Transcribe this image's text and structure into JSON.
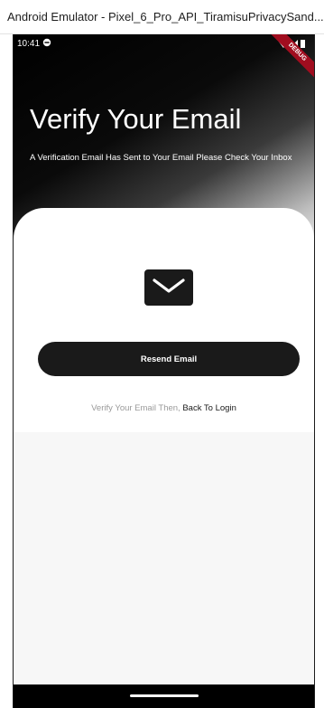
{
  "window": {
    "title": "Android Emulator - Pixel_6_Pro_API_TiramisuPrivacySand..."
  },
  "status_bar": {
    "time": "10:41",
    "debug_label": "DEBUG"
  },
  "hero": {
    "title": "Verify Your Email",
    "subtitle": "A Verification Email Has Sent to Your Email Please Check Your Inbox"
  },
  "card": {
    "icon": "mail-icon",
    "resend_label": "Resend Email",
    "login_prefix": "Verify Your Email Then, ",
    "login_link": "Back To Login"
  },
  "colors": {
    "primary": "#1a1a1a",
    "muted_text": "#9a9a9a",
    "debug_banner": "#a00d1f",
    "background": "#f7f7f7"
  }
}
